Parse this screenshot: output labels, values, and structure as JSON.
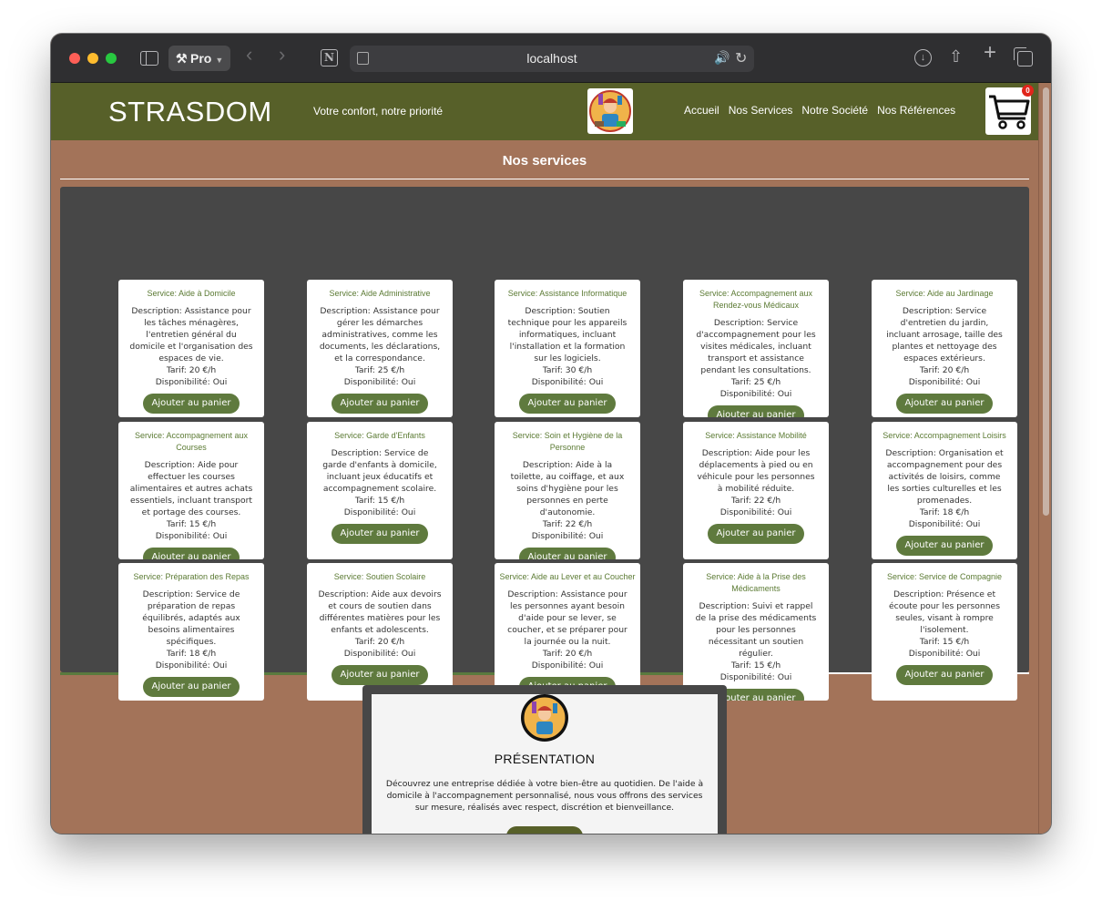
{
  "browser": {
    "profile_label": "Pro",
    "url": "localhost"
  },
  "header": {
    "brand": "STRASDOM",
    "tagline": "Votre confort, notre priorité",
    "nav": [
      "Accueil",
      "Nos Services",
      "Notre Société",
      "Nos Références"
    ],
    "cart_count": "0"
  },
  "services": {
    "title": "Nos services",
    "button_label": "Ajouter au panier",
    "items": [
      {
        "title": "Service: Aide à Domicile",
        "description": "Description: Assistance pour les tâches ménagères, l'entretien général du domicile et l'organisation des espaces de vie.",
        "price": "Tarif: 20 €/h",
        "availability": "Disponibilité: Oui"
      },
      {
        "title": "Service: Aide Administrative",
        "description": "Description: Assistance pour gérer les démarches administratives, comme les documents, les déclarations, et la correspondance.",
        "price": "Tarif: 25 €/h",
        "availability": "Disponibilité: Oui"
      },
      {
        "title": "Service: Assistance Informatique",
        "description": "Description: Soutien technique pour les appareils informatiques, incluant l'installation et la formation sur les logiciels.",
        "price": "Tarif: 30 €/h",
        "availability": "Disponibilité: Oui"
      },
      {
        "title": "Service: Accompagnement aux Rendez-vous Médicaux",
        "description": "Description: Service d'accompagnement pour les visites médicales, incluant transport et assistance pendant les consultations.",
        "price": "Tarif: 25 €/h",
        "availability": "Disponibilité: Oui"
      },
      {
        "title": "Service: Aide au Jardinage",
        "description": "Description: Service d'entretien du jardin, incluant arrosage, taille des plantes et nettoyage des espaces extérieurs.",
        "price": "Tarif: 20 €/h",
        "availability": "Disponibilité: Oui"
      },
      {
        "title": "Service: Accompagnement aux Courses",
        "description": "Description: Aide pour effectuer les courses alimentaires et autres achats essentiels, incluant transport et portage des courses.",
        "price": "Tarif: 15 €/h",
        "availability": "Disponibilité: Oui"
      },
      {
        "title": "Service: Garde d'Enfants",
        "description": "Description: Service de garde d'enfants à domicile, incluant jeux éducatifs et accompagnement scolaire.",
        "price": "Tarif: 15 €/h",
        "availability": "Disponibilité: Oui"
      },
      {
        "title": "Service: Soin et Hygiène de la Personne",
        "description": "Description: Aide à la toilette, au coiffage, et aux soins d'hygiène pour les personnes en perte d'autonomie.",
        "price": "Tarif: 22 €/h",
        "availability": "Disponibilité: Oui"
      },
      {
        "title": "Service: Assistance Mobilité",
        "description": "Description: Aide pour les déplacements à pied ou en véhicule pour les personnes à mobilité réduite.",
        "price": "Tarif: 22 €/h",
        "availability": "Disponibilité: Oui"
      },
      {
        "title": "Service: Accompagnement Loisirs",
        "description": "Description: Organisation et accompagnement pour des activités de loisirs, comme les sorties culturelles et les promenades.",
        "price": "Tarif: 18 €/h",
        "availability": "Disponibilité: Oui"
      },
      {
        "title": "Service: Préparation des Repas",
        "description": "Description: Service de préparation de repas équilibrés, adaptés aux besoins alimentaires spécifiques.",
        "price": "Tarif: 18 €/h",
        "availability": "Disponibilité: Oui"
      },
      {
        "title": "Service: Soutien Scolaire",
        "description": "Description: Aide aux devoirs et cours de soutien dans différentes matières pour les enfants et adolescents.",
        "price": "Tarif: 20 €/h",
        "availability": "Disponibilité: Oui"
      },
      {
        "title": "Service: Aide au Lever et au Coucher",
        "description": "Description: Assistance pour les personnes ayant besoin d'aide pour se lever, se coucher, et se préparer pour la journée ou la nuit.",
        "price": "Tarif: 20 €/h",
        "availability": "Disponibilité: Oui"
      },
      {
        "title": "Service: Aide à la Prise des Médicaments",
        "description": "Description: Suivi et rappel de la prise des médicaments pour les personnes nécessitant un soutien régulier.",
        "price": "Tarif: 15 €/h",
        "availability": "Disponibilité: Oui"
      },
      {
        "title": "Service: Service de Compagnie",
        "description": "Description: Présence et écoute pour les personnes seules, visant à rompre l'isolement.",
        "price": "Tarif: 15 €/h",
        "availability": "Disponibilité: Oui"
      }
    ]
  },
  "presentation": {
    "heading": "PRÉSENTATION",
    "text": "Découvrez une entreprise dédiée à votre bien-être au quotidien. De l'aide à domicile à l'accompagnement personnalisé, nous vous offrons des services sur mesure, réalisés avec respect, discrétion et bienveillance."
  }
}
